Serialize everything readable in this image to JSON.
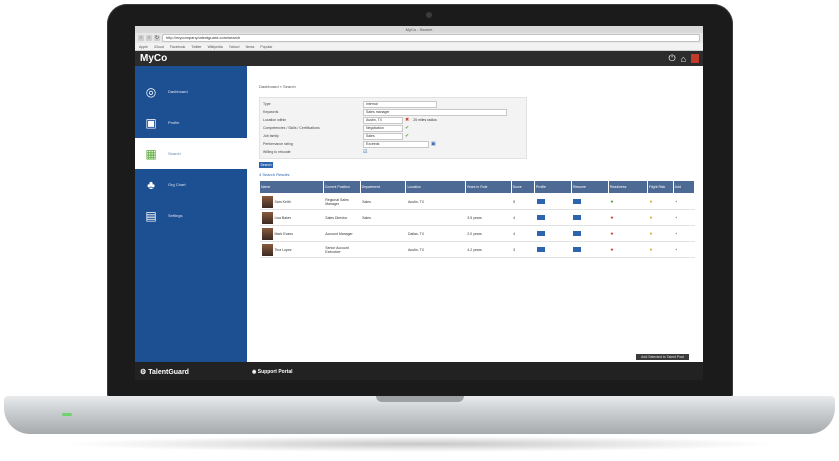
{
  "browser": {
    "window_title": "MyCo - Search",
    "url": "http://mycompany.talentguard.com/search",
    "bookmarks": [
      "Apple",
      "iCloud",
      "Facebook",
      "Twitter",
      "Wikipedia",
      "Yahoo!",
      "News",
      "Popular"
    ]
  },
  "header": {
    "logo": "MyCo",
    "icons": [
      "power-icon",
      "home-icon",
      "user-icon"
    ]
  },
  "sidebar": {
    "items": [
      {
        "label": "Dashboard",
        "icon": "dashboard-icon",
        "glyph": "◎",
        "active": false
      },
      {
        "label": "Profile",
        "icon": "profile-icon",
        "glyph": "▣",
        "active": false
      },
      {
        "label": "Search",
        "icon": "search-users-icon",
        "glyph": "▦",
        "active": true
      },
      {
        "label": "Org Chart",
        "icon": "org-chart-icon",
        "glyph": "♣",
        "active": false
      },
      {
        "label": "Settings",
        "icon": "settings-icon",
        "glyph": "▤",
        "active": false
      }
    ]
  },
  "footer": {
    "brand": "TalentGuard",
    "support": "Support Portal"
  },
  "main": {
    "breadcrumb": "Dashboard » Search",
    "form": {
      "rows": [
        {
          "label": "Type",
          "value": "Internal",
          "mark": ""
        },
        {
          "label": "Keywords",
          "value": "Sales manager",
          "mark": ""
        },
        {
          "label": "Location within",
          "value": "Austin, TX",
          "mark": "x",
          "extra": "25 miles radius"
        },
        {
          "label": "Competencies / Skills / Certifications",
          "value": "Negotiation",
          "mark": "tick"
        },
        {
          "label": "Job family",
          "value": "Sales",
          "mark": "tick"
        },
        {
          "label": "Performance rating",
          "value": "Exceeds",
          "mark": ""
        },
        {
          "label": "Willing to relocate",
          "value": "",
          "mark": ""
        }
      ],
      "search_label": "Search"
    },
    "result_count": "4 Search Results",
    "table": {
      "headers": [
        "Name",
        "Current Position",
        "Department",
        "Location",
        "Years in Role",
        "Score",
        "Profile",
        "Resume",
        "Readiness",
        "Flight Risk",
        "Add"
      ],
      "rows": [
        {
          "name": "Sam Keith",
          "position": "Regional Sales Manager",
          "department": "Sales",
          "location": "Austin, TX",
          "years": "",
          "score": "5",
          "readiness": "green",
          "risk": "yellow"
        },
        {
          "name": "Lisa Baker",
          "position": "Sales Director",
          "department": "Sales",
          "location": "",
          "years": "3.5 years",
          "score": "4",
          "readiness": "red",
          "risk": "yellow"
        },
        {
          "name": "Mark Evans",
          "position": "Account Manager",
          "department": "",
          "location": "Dallas, TX",
          "years": "2.0 years",
          "score": "4",
          "readiness": "red",
          "risk": "yellow"
        },
        {
          "name": "Tina Lopez",
          "position": "Senior Account Executive",
          "department": "",
          "location": "Austin, TX",
          "years": "4.2 years",
          "score": "3",
          "readiness": "red",
          "risk": "yellow"
        }
      ]
    },
    "actions_label": "Add Selected to Talent Pool"
  },
  "colors": {
    "sidebar": "#1d4f93",
    "header": "#2c2c2c",
    "table_header": "#4c6a94",
    "accent": "#2d64ad"
  }
}
